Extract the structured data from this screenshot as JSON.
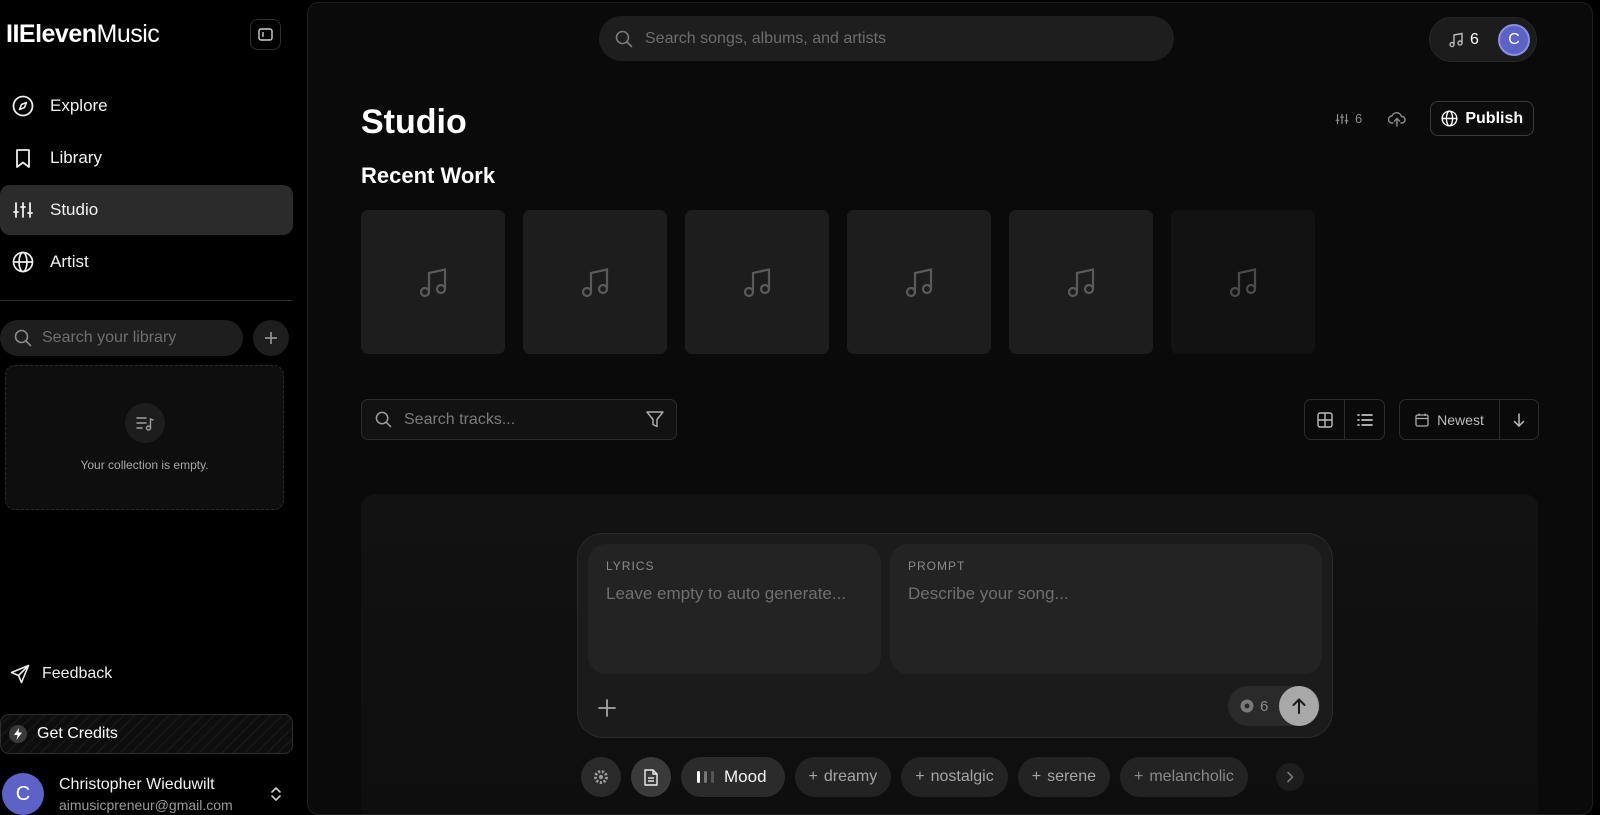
{
  "brand": {
    "bold": "IIEleven",
    "light": "Music"
  },
  "sidebar": {
    "nav": [
      {
        "label": "Explore",
        "icon": "compass-icon"
      },
      {
        "label": "Library",
        "icon": "bookmark-icon"
      },
      {
        "label": "Studio",
        "icon": "sliders-icon",
        "active": true
      },
      {
        "label": "Artist",
        "icon": "globe-icon"
      }
    ],
    "library_search_placeholder": "Search your library",
    "empty_text": "Your collection is empty.",
    "feedback_label": "Feedback",
    "credits_label": "Get Credits",
    "user": {
      "initial": "C",
      "name": "Christopher Wieduwilt",
      "email": "aimusicpreneur@gmail.com"
    }
  },
  "topbar": {
    "search_placeholder": "Search songs, albums, and artists",
    "credits": "6",
    "avatar_initial": "C"
  },
  "studio": {
    "title": "Studio",
    "count": "6",
    "publish_label": "Publish",
    "recent_title": "Recent Work",
    "tile_count": 6,
    "track_search_placeholder": "Search tracks...",
    "sort_label": "Newest"
  },
  "composer": {
    "lyrics_label": "LYRICS",
    "lyrics_placeholder": "Leave empty to auto generate...",
    "prompt_label": "PROMPT",
    "prompt_placeholder": "Describe your song...",
    "cost": "6"
  },
  "chips": {
    "mood_label": "Mood",
    "tags": [
      "dreamy",
      "nostalgic",
      "serene",
      "melancholic"
    ]
  },
  "colors": {
    "accent_avatar": "#5d63c6",
    "active_nav": "#2b2b2b"
  }
}
